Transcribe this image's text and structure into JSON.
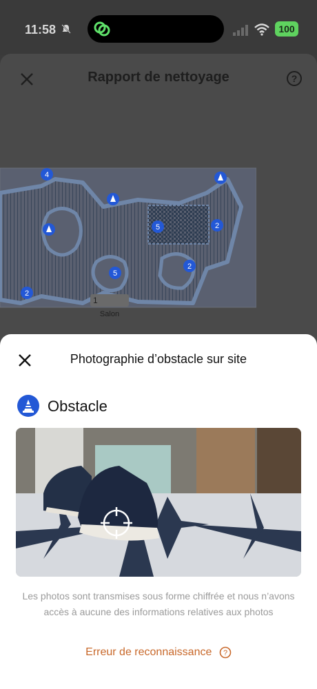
{
  "status_bar": {
    "time": "11:58",
    "battery": "100"
  },
  "background_screen": {
    "title": "Rapport de nettoyage",
    "room_label": "Salon",
    "room_badge": "1",
    "map_markers": [
      "4",
      "5",
      "2",
      "5",
      "2",
      "2"
    ]
  },
  "sheet": {
    "title": "Photographie d’obstacle sur site",
    "obstacle_label": "Obstacle",
    "caption": "Les photos sont transmises sous forme chiffrée et nous n’avons accès à aucune des informations relatives aux photos",
    "error_link": "Erreur de reconnaissance"
  },
  "colors": {
    "accent_blue": "#2358d6",
    "link_orange": "#c8682a",
    "battery_green": "#5fd35f"
  },
  "icons": {
    "close": "close-icon",
    "help": "help-icon",
    "obstacle": "traffic-cone-icon",
    "target": "crosshair-icon"
  }
}
